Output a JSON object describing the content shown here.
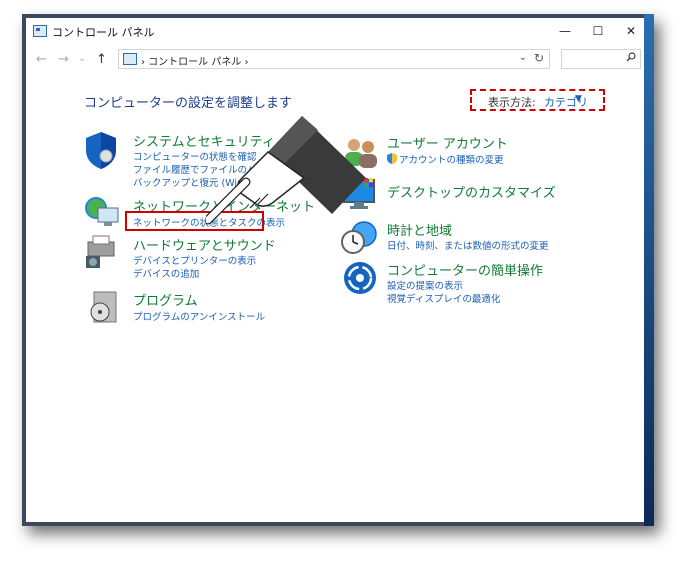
{
  "window": {
    "title": "コントロール パネル",
    "controls": {
      "minimize": "—",
      "maximize": "☐",
      "close": "✕"
    }
  },
  "addressbar": {
    "back": "←",
    "forward": "→",
    "recent": "⌄",
    "up": "↑",
    "path": "› コントロール パネル ›",
    "dropdown": "⌄",
    "refresh": "↻",
    "search_placeholder": ""
  },
  "main": {
    "heading": "コンピューターの設定を調整します",
    "view_by": {
      "label": "表示方法:",
      "value": "カテゴリ"
    }
  },
  "categories_left": [
    {
      "title": "システムとセキュリティ",
      "links": [
        "コンピューターの状態を確認",
        "ファイル履歴でファイルのバックアップ",
        "バックアップと復元 (Windows"
      ]
    },
    {
      "title": "ネットワークとインターネット",
      "links": [
        "ネットワークの状態とタスクの表示"
      ]
    },
    {
      "title": "ハードウェアとサウンド",
      "links": [
        "デバイスとプリンターの表示",
        "デバイスの追加"
      ]
    },
    {
      "title": "プログラム",
      "links": [
        "プログラムのアンインストール"
      ]
    }
  ],
  "categories_right": [
    {
      "title": "ユーザー アカウント",
      "links": [
        "アカウントの種類の変更"
      ]
    },
    {
      "title": "デスクトップのカスタマイズ",
      "links": []
    },
    {
      "title": "時計と地域",
      "links": [
        "日付、時刻、または数値の形式の変更"
      ]
    },
    {
      "title": "コンピューターの簡単操作",
      "links": [
        "設定の提案の表示",
        "視覚ディスプレイの最適化"
      ]
    }
  ],
  "colors": {
    "accent": "#1a5fb4",
    "category_title": "#117a35",
    "highlight": "#d10000"
  },
  "icons": [
    "shield-icon",
    "network-globe-icon",
    "printer-speaker-icon",
    "programs-disc-icon",
    "users-icon",
    "desktop-paint-icon",
    "clock-globe-icon",
    "ease-of-access-icon",
    "pointing-hand-icon"
  ]
}
